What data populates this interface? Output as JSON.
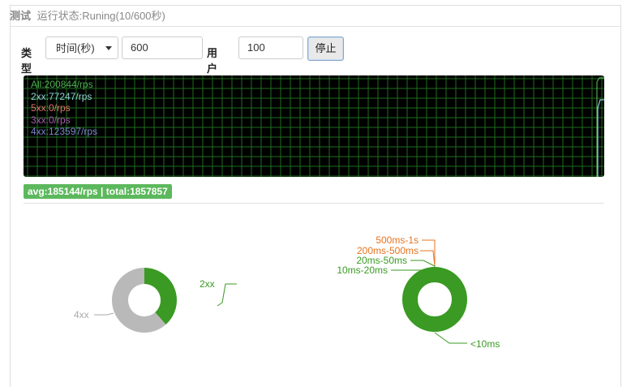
{
  "header": {
    "title": "测试",
    "status": "运行状态:Runing(10/600秒)"
  },
  "controls": {
    "type_label": "类型",
    "type_selected": "时间(秒)",
    "duration_value": "600",
    "users_label": "用户数",
    "users_value": "100",
    "stop_label": "停止"
  },
  "monitor": {
    "legend": [
      {
        "text": "All:200844/rps",
        "color": "#4caf50"
      },
      {
        "text": "2xx:77247/rps",
        "color": "#8fd0d8"
      },
      {
        "text": "5xx:0/rps",
        "color": "#e0736a"
      },
      {
        "text": "3xx:0/rps",
        "color": "#a85ab0"
      },
      {
        "text": "4xx:123597/rps",
        "color": "#7a84cc"
      }
    ],
    "grid_color": "#1e6e1e"
  },
  "summary": "avg:185144/rps | total:1857857",
  "status_pie": {
    "slices": [
      {
        "label": "2xx",
        "fraction": 0.385,
        "color": "#3a9a23"
      },
      {
        "label": "4xx",
        "fraction": 0.615,
        "color": "#b9b9b9"
      }
    ]
  },
  "latency_pie": {
    "slices": [
      {
        "label": "<10ms",
        "fraction": 1.0,
        "color": "#3a9a23"
      },
      {
        "label": "10ms-20ms",
        "fraction": 0,
        "color": "#3a9a23"
      },
      {
        "label": "20ms-50ms",
        "fraction": 0,
        "color": "#3a9a23"
      },
      {
        "label": "200ms-500ms",
        "fraction": 0,
        "color": "#e8731e"
      },
      {
        "label": "500ms-1s",
        "fraction": 0,
        "color": "#e8731e"
      }
    ]
  }
}
